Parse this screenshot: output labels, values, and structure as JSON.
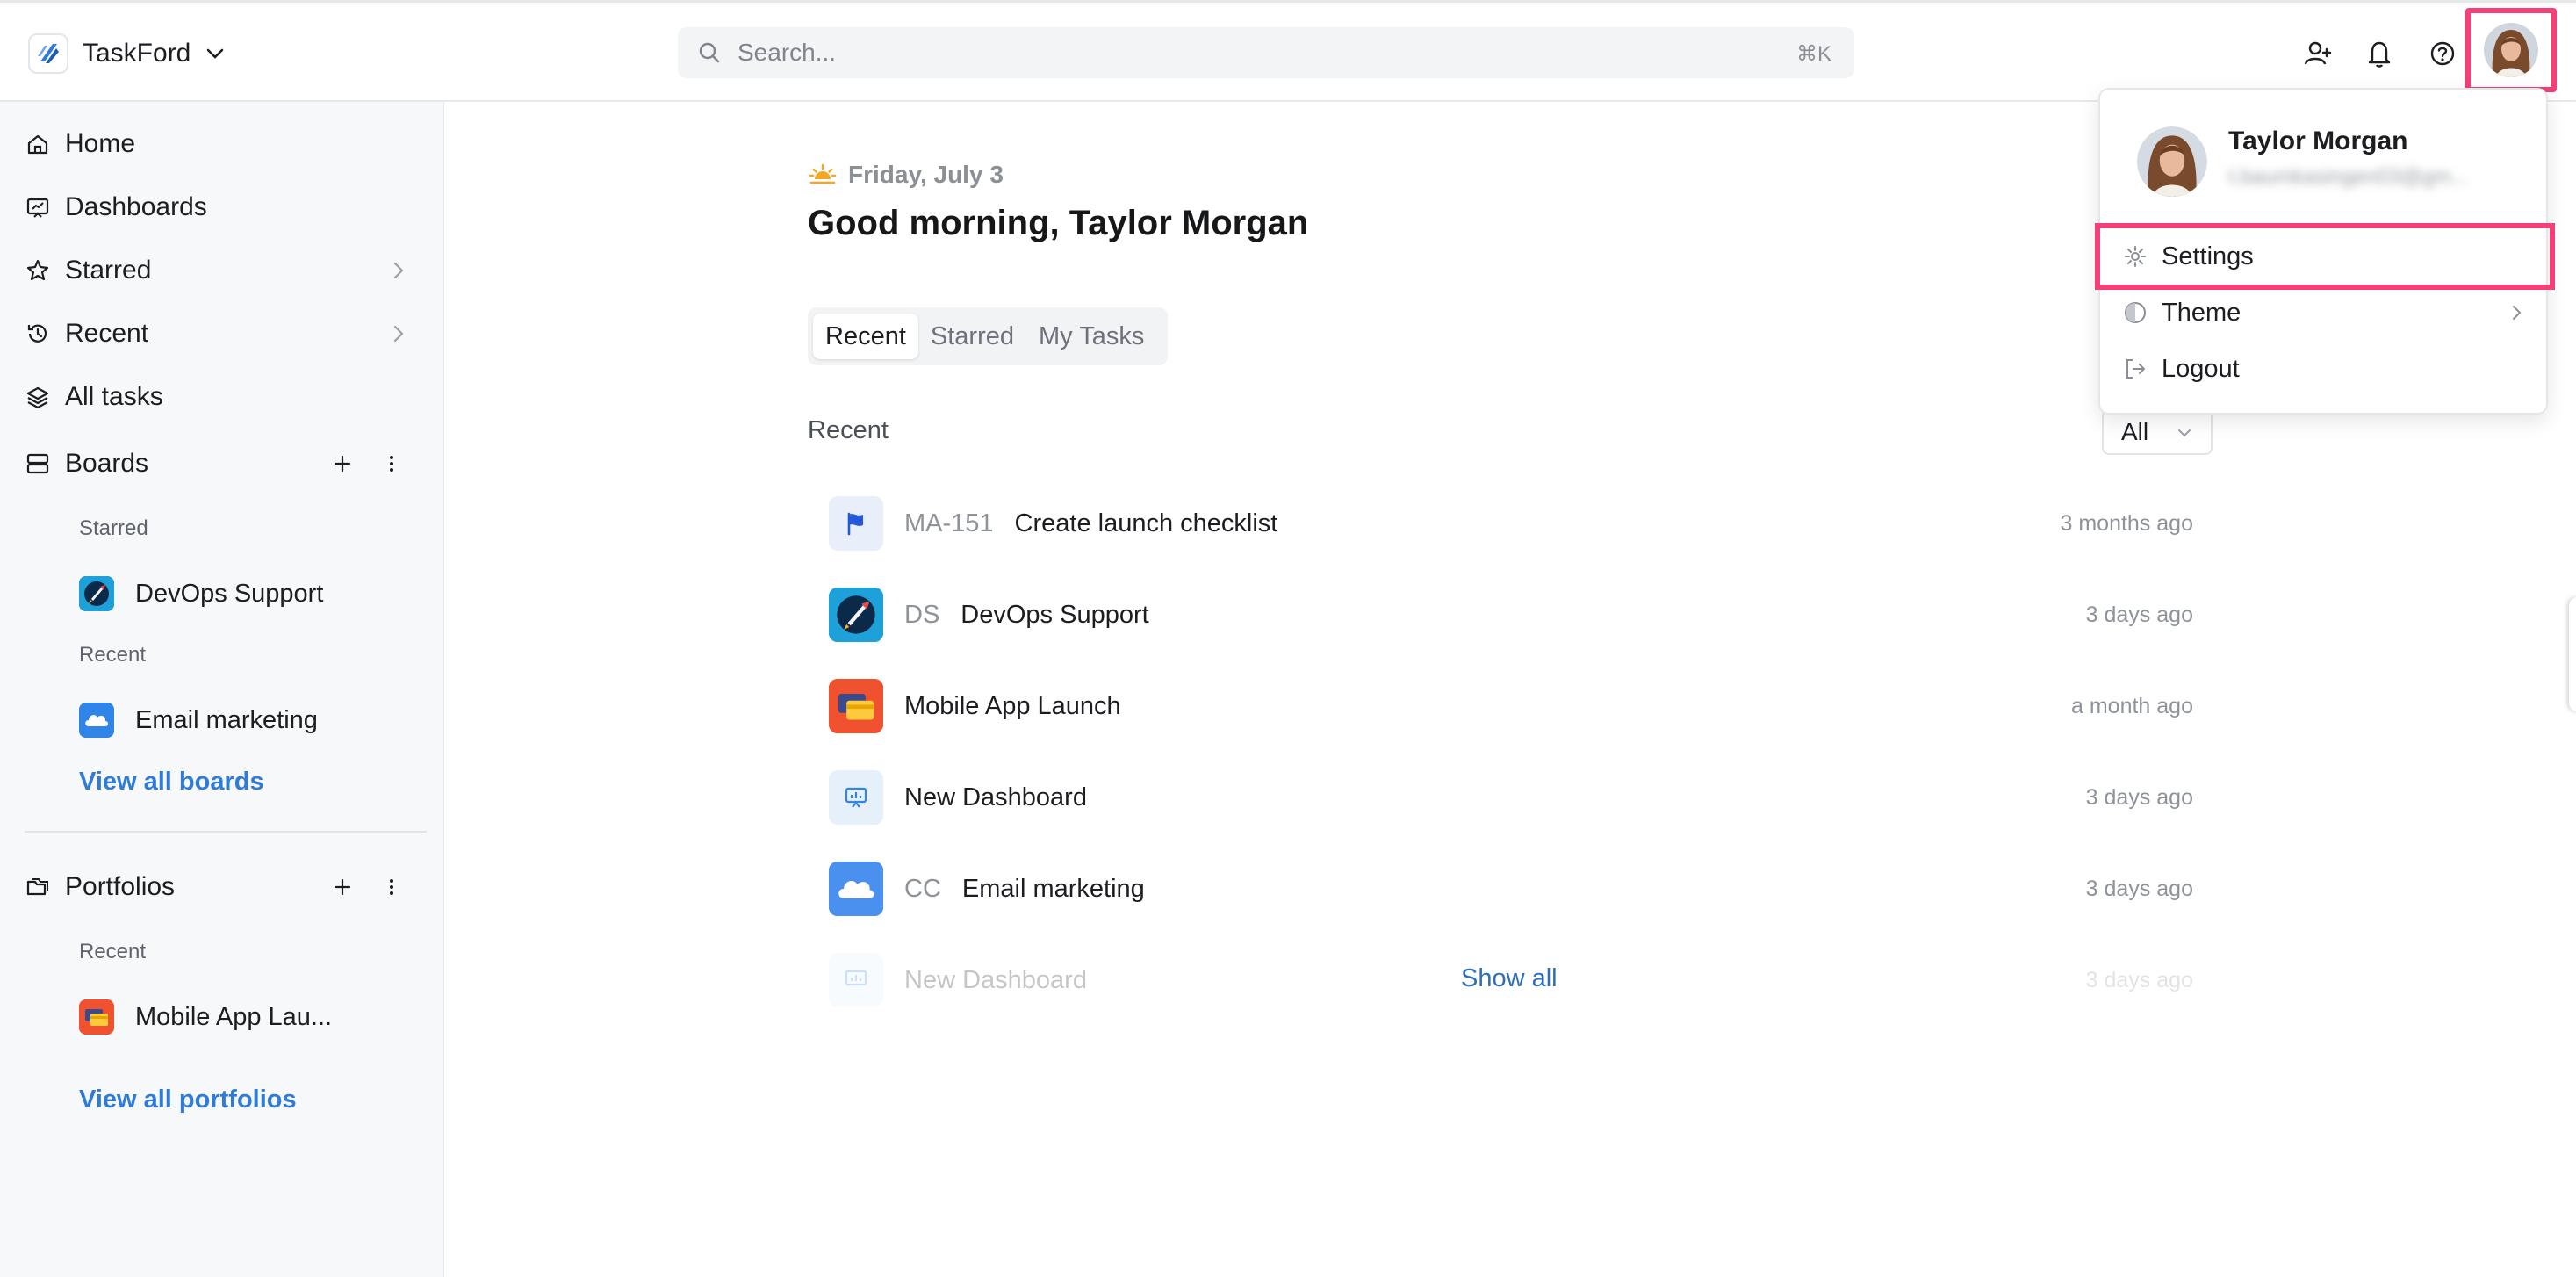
{
  "app": {
    "name": "TaskFord"
  },
  "search": {
    "placeholder": "Search...",
    "shortcut": "⌘K"
  },
  "sidebar": {
    "nav": [
      {
        "label": "Home"
      },
      {
        "label": "Dashboards"
      },
      {
        "label": "Starred"
      },
      {
        "label": "Recent"
      },
      {
        "label": "All tasks"
      }
    ],
    "boards": {
      "label": "Boards",
      "starred_label": "Starred",
      "starred_item": "DevOps Support",
      "recent_label": "Recent",
      "recent_item": "Email marketing",
      "view_all": "View all boards"
    },
    "portfolios": {
      "label": "Portfolios",
      "recent_label": "Recent",
      "recent_item": "Mobile App Lau...",
      "view_all": "View all portfolios"
    }
  },
  "main": {
    "date": "Friday, July 3",
    "greeting": "Good morning, Taylor Morgan",
    "tabs": [
      "Recent",
      "Starred",
      "My Tasks"
    ],
    "active_tab": "Recent",
    "section_label": "Recent",
    "filter_value": "All",
    "rows": [
      {
        "key": "MA-151",
        "title": "Create launch checklist",
        "time": "3 months ago",
        "icon": "flag-icon"
      },
      {
        "key": "DS",
        "title": "DevOps Support",
        "time": "3 days ago",
        "icon": "rocket-icon"
      },
      {
        "key": "",
        "title": "Mobile App Launch",
        "time": "a month ago",
        "icon": "cards-icon"
      },
      {
        "key": "",
        "title": "New Dashboard",
        "time": "3 days ago",
        "icon": "dashboard-icon"
      },
      {
        "key": "CC",
        "title": "Email marketing",
        "time": "3 days ago",
        "icon": "cloud-icon"
      },
      {
        "key": "",
        "title": "New Dashboard",
        "time": "3 days ago",
        "icon": "dashboard-icon"
      }
    ],
    "show_all": "Show all"
  },
  "user_menu": {
    "name": "Taylor Morgan",
    "email": "t.baumkasingen03@gm...",
    "items": [
      {
        "label": "Settings",
        "icon": "gear-icon"
      },
      {
        "label": "Theme",
        "icon": "theme-icon"
      },
      {
        "label": "Logout",
        "icon": "logout-icon"
      }
    ]
  },
  "colors": {
    "accent": "#2f7bd6",
    "highlight": "#f43f77"
  }
}
